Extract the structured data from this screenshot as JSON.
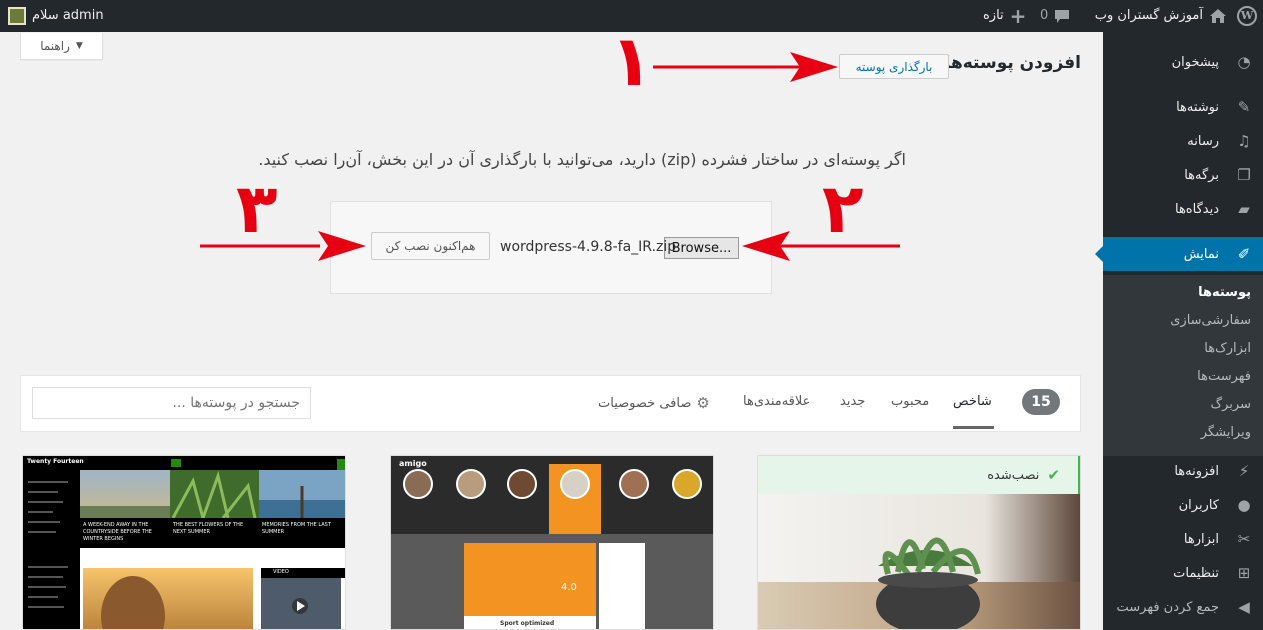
{
  "adminbar": {
    "site_name": "آموزش گستران وب",
    "comments_count": "0",
    "new_label": "تازه",
    "greeting": "سلام admin"
  },
  "sidebar": {
    "dashboard": "پیشخوان",
    "posts": "نوشته‌ها",
    "media": "رسانه",
    "pages": "برگه‌ها",
    "comments": "دیدگاه‌ها",
    "appearance": "نمایش",
    "submenu": [
      "پوسته‌ها",
      "سفارشی‌سازی",
      "ابزارک‌ها",
      "فهرست‌ها",
      "سربرگ",
      "ویرایشگر"
    ],
    "plugins": "افزونه‌ها",
    "users": "کاربران",
    "tools": "ابزارها",
    "settings": "تنظیمات",
    "collapse": "جمع کردن فهرست"
  },
  "help": {
    "label": "راهنما"
  },
  "header": {
    "title": "افزودن پوسته‌ها",
    "upload_label": "بارگذاری پوسته"
  },
  "upload": {
    "description": "اگر پوسته‌ای در ساختار فشرده (zip) دارید، می‌توانید با بارگذاری آن در این بخش، آن‌را نصب کنید.",
    "browse_label": "Browse...",
    "filename": "wordpress-4.9.8-fa_IR.zip",
    "install_label": "هم‌اکنون نصب کن"
  },
  "annotations": {
    "one": "۱",
    "two": "۲",
    "three": "۳",
    "color": "#e60012"
  },
  "filter": {
    "count": "15",
    "tabs": [
      "شاخص",
      "محبوب",
      "جدید",
      "علاقه‌مندی‌ها"
    ],
    "feature_filter": "صافی خصوصیات",
    "search_placeholder": "جستجو در پوسته‌ها ..."
  },
  "themes": {
    "installed_label": "نصب‌شده",
    "amigo_logo": "amigo",
    "amigo_rating": "4.0",
    "amigo_caption": "Sport optimized",
    "tf_site": "Twenty Fourteen",
    "tf_post1": "A WEEK-END AWAY IN THE COUNTRYSIDE BEFORE THE WINTER BEGINS",
    "tf_post2": "THE BEST FLOWERS OF THE NEXT SUMMER",
    "tf_post3": "MEMORIES FROM THE LAST SUMMER",
    "tf_video": "VIDEO"
  },
  "colors": {
    "adminbar": "#23282d",
    "accent": "#0073aa",
    "installed_green": "#46b450",
    "amigo_orange": "#f39322"
  }
}
